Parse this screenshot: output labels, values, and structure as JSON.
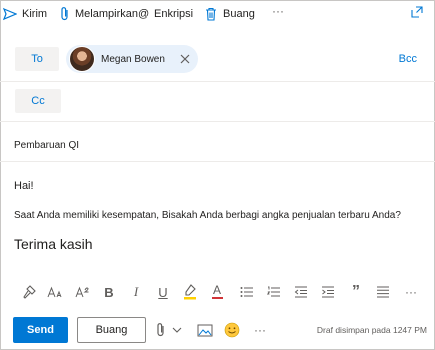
{
  "toolbar": {
    "send_label": "Kirim",
    "attach_label": "Melampirkan",
    "mention_label": "@",
    "encrypt_label": "Enkripsi",
    "discard_label": "Buang",
    "more_label": "···"
  },
  "recipients": {
    "to_label": "To",
    "cc_label": "Cc",
    "bcc_label": "Bcc",
    "to_list": [
      {
        "name": "Megan Bowen"
      }
    ]
  },
  "subject": "Pembaruan QI",
  "body": {
    "greeting": "Hai!",
    "text": "Saat Anda memiliki kesempatan, Bisakah Anda berbagi angka penjualan terbaru Anda?",
    "signoff": "Terima kasih"
  },
  "format_bar": {
    "bold": "B",
    "italic": "I",
    "underline": "U",
    "font_color": "A",
    "quote": "”",
    "more": "···"
  },
  "actions": {
    "send_label": "Send",
    "discard_label": "Buang",
    "more_label": "···",
    "draft_status": "Draf disimpan pada 1247 PM"
  },
  "colors": {
    "accent": "#0078d4",
    "highlight": "#ffd000",
    "font_color_bar": "#d13438"
  }
}
